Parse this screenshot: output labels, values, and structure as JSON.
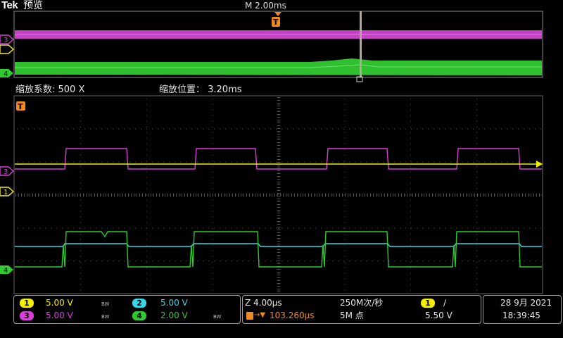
{
  "header": {
    "brand": "Tek",
    "brand_suffix": "预览",
    "time_per_div": "M 2.00ms"
  },
  "zoom": {
    "factor_label": "缩放系数: 500 X",
    "position_label": "缩放位置：  3.20ms"
  },
  "markers": {
    "trigger_marker": "T",
    "ch3": "3",
    "ch1": "1",
    "ch4": "4"
  },
  "channels": [
    {
      "id": "1",
      "scale": "5.00 V",
      "color": "#f2f000",
      "bw": "BW"
    },
    {
      "id": "2",
      "scale": "5.00 V",
      "color": "#35d6e6",
      "bw": ""
    },
    {
      "id": "3",
      "scale": "5.00 V",
      "color": "#d640d6",
      "bw": "BW"
    },
    {
      "id": "4",
      "scale": "2.00 V",
      "color": "#2fca2f",
      "bw": "BW"
    }
  ],
  "timebase": {
    "zoom_scale": "Z 4.00µs",
    "trigger_pos": "103.260µs",
    "sample_rate": "250M次/秒",
    "record_length": "5M 点"
  },
  "trigger": {
    "source": "1",
    "slope": "∕",
    "level": "5.50 V"
  },
  "datetime": {
    "date": "28 9月 2021",
    "time": "18:39:45"
  }
}
